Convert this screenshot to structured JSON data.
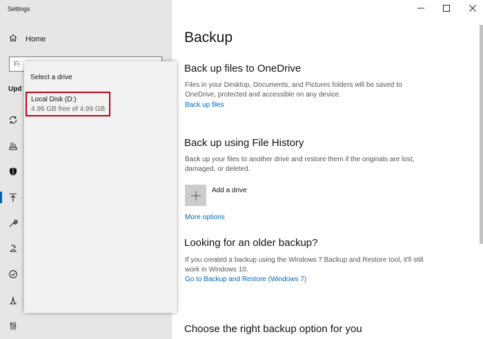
{
  "window": {
    "title": "Settings"
  },
  "sidebar": {
    "home_label": "Home",
    "search_placeholder": "Fi",
    "section_label": "Upd",
    "nav_icons": [
      "sync-icon",
      "delivery-icon",
      "shield-icon",
      "backup-icon",
      "wrench-icon",
      "recovery-icon",
      "activation-icon",
      "find-device-icon",
      "developer-icon"
    ],
    "active_index": 3
  },
  "drive_picker": {
    "title": "Select a drive",
    "drives": [
      {
        "name": "Local Disk (D:)",
        "space": "4.96 GB free of 4.99 GB"
      }
    ]
  },
  "main": {
    "title": "Backup",
    "onedrive": {
      "heading": "Back up files to OneDrive",
      "description": "Files in your Desktop, Documents, and Pictures folders will be saved to OneDrive, protected and accessible on any device.",
      "link": "Back up files"
    },
    "file_history": {
      "heading": "Back up using File History",
      "description": "Back up your files to another drive and restore them if the originals are lost, damaged, or deleted.",
      "add_drive_label": "Add a drive",
      "more_options": "More options"
    },
    "older_backup": {
      "heading": "Looking for an older backup?",
      "description": "If you created a backup using the Windows 7 Backup and Restore tool, it'll still work in Windows 10.",
      "link": "Go to Backup and Restore (Windows 7)"
    },
    "choose": {
      "heading": "Choose the right backup option for you"
    }
  },
  "colors": {
    "accent": "#0067b8",
    "highlight_border": "#c00016",
    "sidebar_bg": "#e6e6e6"
  }
}
